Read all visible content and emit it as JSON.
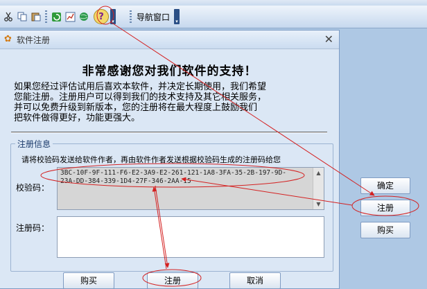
{
  "menubar": {
    "items": [
      "",
      "",
      "",
      "",
      "",
      "",
      "",
      "",
      "",
      "",
      ""
    ]
  },
  "toolbar": {
    "icons": [
      "cut-icon",
      "copy-icon",
      "paste-icon",
      "refresh-icon",
      "chart-icon",
      "globe-icon",
      "help-icon"
    ],
    "help_glyph": "?",
    "nav_window_label": "导航窗口"
  },
  "dialog": {
    "title": "软件注册",
    "close_glyph": "✕",
    "headline": "非常感谢您对我们软件的支持！",
    "intro_lines": [
      "如果您经过评估试用后喜欢本软件，并决定长期使用，我们希望",
      "您能注册。注册用户可以得到我们的技术支持及其它相关服务，",
      "并可以免费升级到新版本，您的注册将在最大程度上鼓励我们",
      "把软件做得更好，功能更强大。"
    ],
    "group_label": "注册信息",
    "instruction": "请将校验码发送给软件作者，再由软件作者发送根据校验码生成的注册码给您",
    "check_code_label": "校验码：",
    "check_code_lines": [
      "3BC-10F-9F-111-F6-E2-3A9-E2-261-121-1A8-3FA-35-2B-197-9D-",
      "23A-DD-384-339-1D4-27F-346-2AA-15"
    ],
    "reg_code_label": "注册码：",
    "reg_code_value": "",
    "buttons": {
      "buy": "购买",
      "register": "注册",
      "cancel": "取消"
    }
  },
  "side_buttons": {
    "confirm": "确定",
    "register": "注册",
    "buy": "购买"
  },
  "colors": {
    "annotation": "#d42020",
    "background": "#aec8e4",
    "dialog_bg": "#dbe7f5"
  }
}
